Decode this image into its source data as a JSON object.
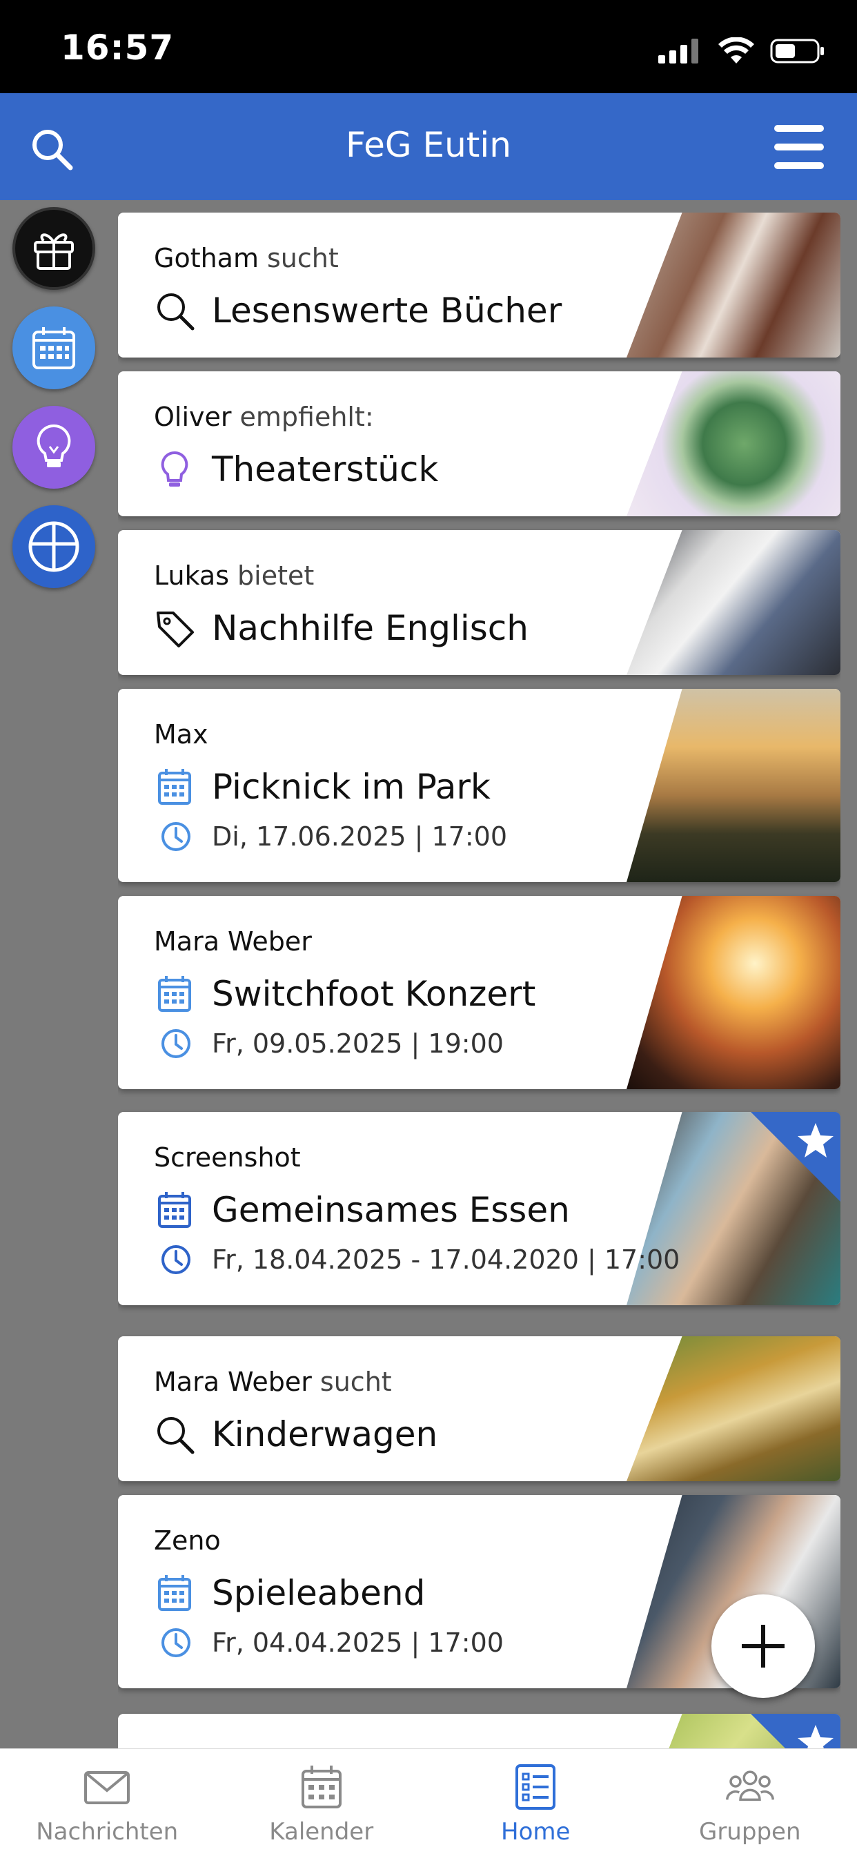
{
  "status": {
    "time": "16:57"
  },
  "header": {
    "title": "FeG Eutin"
  },
  "colors": {
    "brand": "#3568c8",
    "accent": "#2f6fd8",
    "idea": "#8f5fe0",
    "background": "#7a7a7a"
  },
  "rail": [
    {
      "icon": "gift-icon",
      "color": "#111111"
    },
    {
      "icon": "calendar-icon",
      "color": "#4a90e2"
    },
    {
      "icon": "lightbulb-icon",
      "color": "#8f5fe0"
    },
    {
      "icon": "cross-icon",
      "color": "#2e63c9"
    }
  ],
  "feed": {
    "cards": [
      {
        "author": "Gotham",
        "verb": "sucht",
        "icon": "search-icon",
        "title": "Lesenswerte Bücher",
        "image": "book-photo"
      },
      {
        "author": "Oliver",
        "verb": "empfiehlt:",
        "icon": "lightbulb-icon",
        "title": "Theaterstück",
        "image": "succulent-photo"
      },
      {
        "author": "Lukas",
        "verb": "bietet",
        "icon": "tag-icon",
        "title": "Nachhilfe Englisch",
        "image": "desk-photo"
      },
      {
        "author": "Max",
        "verb": "",
        "icon": "calendar-icon",
        "title": "Picknick im Park",
        "date": "Di, 17.06.2025 | 17:00",
        "image": "picnic-photo"
      },
      {
        "author": "Mara Weber",
        "verb": "",
        "icon": "calendar-icon",
        "title": "Switchfoot Konzert",
        "date": "Fr, 09.05.2025 | 19:00",
        "image": "concert-photo"
      },
      {
        "author": "Screenshot",
        "verb": "",
        "icon": "calendar-icon",
        "title": "Gemeinsames Essen",
        "date": "Fr, 18.04.2025 - 17.04.2020 | 17:00",
        "image": "friends-photo",
        "starred": true
      },
      {
        "author": "Mara Weber",
        "verb": "sucht",
        "icon": "search-icon",
        "title": "Kinderwagen",
        "image": "family-photo"
      },
      {
        "author": "Zeno",
        "verb": "",
        "icon": "calendar-icon",
        "title": "Spieleabend",
        "date": "Fr, 04.04.2025 | 17:00",
        "image": "office-photo"
      }
    ]
  },
  "tabbar": {
    "tabs": [
      {
        "label": "Nachrichten",
        "icon": "envelope-icon"
      },
      {
        "label": "Kalender",
        "icon": "calendar-icon"
      },
      {
        "label": "Home",
        "icon": "list-icon",
        "active": true
      },
      {
        "label": "Gruppen",
        "icon": "people-icon"
      }
    ]
  }
}
